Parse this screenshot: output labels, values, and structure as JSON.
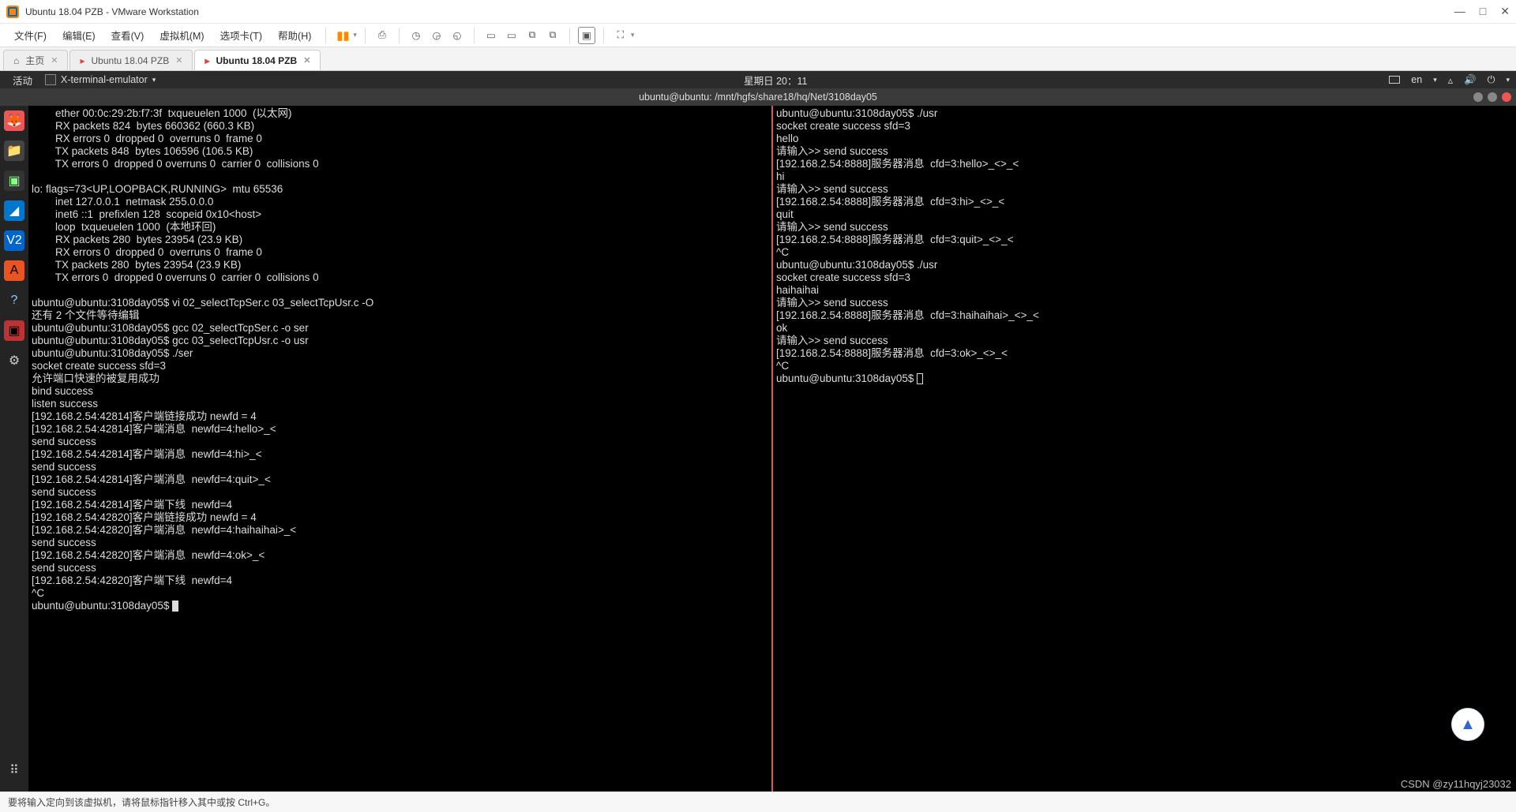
{
  "window": {
    "title": "Ubuntu 18.04 PZB - VMware Workstation"
  },
  "menu": {
    "file": "文件(F)",
    "edit": "编辑(E)",
    "view": "查看(V)",
    "vm": "虚拟机(M)",
    "tabs": "选项卡(T)",
    "help": "帮助(H)"
  },
  "tabs": [
    {
      "label": "主页",
      "active": false,
      "icon": "home"
    },
    {
      "label": "Ubuntu 18.04 PZB",
      "active": false,
      "icon": "vm"
    },
    {
      "label": "Ubuntu 18.04 PZB",
      "active": true,
      "icon": "vm"
    }
  ],
  "gnome": {
    "activities": "活动",
    "app": "X-terminal-emulator",
    "clock": "星期日 20：11",
    "lang": "en"
  },
  "term": {
    "title": "ubuntu@ubuntu: /mnt/hgfs/share18/hq/Net/3108day05",
    "left": "        ether 00:0c:29:2b:f7:3f  txqueuelen 1000  (以太网)\n        RX packets 824  bytes 660362 (660.3 KB)\n        RX errors 0  dropped 0  overruns 0  frame 0\n        TX packets 848  bytes 106596 (106.5 KB)\n        TX errors 0  dropped 0 overruns 0  carrier 0  collisions 0\n\nlo: flags=73<UP,LOOPBACK,RUNNING>  mtu 65536\n        inet 127.0.0.1  netmask 255.0.0.0\n        inet6 ::1  prefixlen 128  scopeid 0x10<host>\n        loop  txqueuelen 1000  (本地环回)\n        RX packets 280  bytes 23954 (23.9 KB)\n        RX errors 0  dropped 0  overruns 0  frame 0\n        TX packets 280  bytes 23954 (23.9 KB)\n        TX errors 0  dropped 0 overruns 0  carrier 0  collisions 0\n\nubuntu@ubuntu:3108day05$ vi 02_selectTcpSer.c 03_selectTcpUsr.c -O\n还有 2 个文件等待编辑\nubuntu@ubuntu:3108day05$ gcc 02_selectTcpSer.c -o ser\nubuntu@ubuntu:3108day05$ gcc 03_selectTcpUsr.c -o usr\nubuntu@ubuntu:3108day05$ ./ser\nsocket create success sfd=3\n允许端口快速的被复用成功\nbind success\nlisten success\n[192.168.2.54:42814]客户端链接成功 newfd = 4\n[192.168.2.54:42814]客户端消息  newfd=4:hello>_<\nsend success\n[192.168.2.54:42814]客户端消息  newfd=4:hi>_<\nsend success\n[192.168.2.54:42814]客户端消息  newfd=4:quit>_<\nsend success\n[192.168.2.54:42814]客户端下线  newfd=4\n[192.168.2.54:42820]客户端链接成功 newfd = 4\n[192.168.2.54:42820]客户端消息  newfd=4:haihaihai>_<\nsend success\n[192.168.2.54:42820]客户端消息  newfd=4:ok>_<\nsend success\n[192.168.2.54:42820]客户端下线  newfd=4\n^C\nubuntu@ubuntu:3108day05$ ",
    "right": "ubuntu@ubuntu:3108day05$ ./usr\nsocket create success sfd=3\nhello\n请输入>> send success\n[192.168.2.54:8888]服务器消息  cfd=3:hello>_<>_<\nhi\n请输入>> send success\n[192.168.2.54:8888]服务器消息  cfd=3:hi>_<>_<\nquit\n请输入>> send success\n[192.168.2.54:8888]服务器消息  cfd=3:quit>_<>_<\n^C\nubuntu@ubuntu:3108day05$ ./usr\nsocket create success sfd=3\nhaihaihai\n请输入>> send success\n[192.168.2.54:8888]服务器消息  cfd=3:haihaihai>_<>_<\nok\n请输入>> send success\n[192.168.2.54:8888]服务器消息  cfd=3:ok>_<>_<\n^C\nubuntu@ubuntu:3108day05$ "
  },
  "status": "要将输入定向到该虚拟机，请将鼠标指针移入其中或按 Ctrl+G。",
  "watermark": "CSDN @zy11hqyj23032"
}
